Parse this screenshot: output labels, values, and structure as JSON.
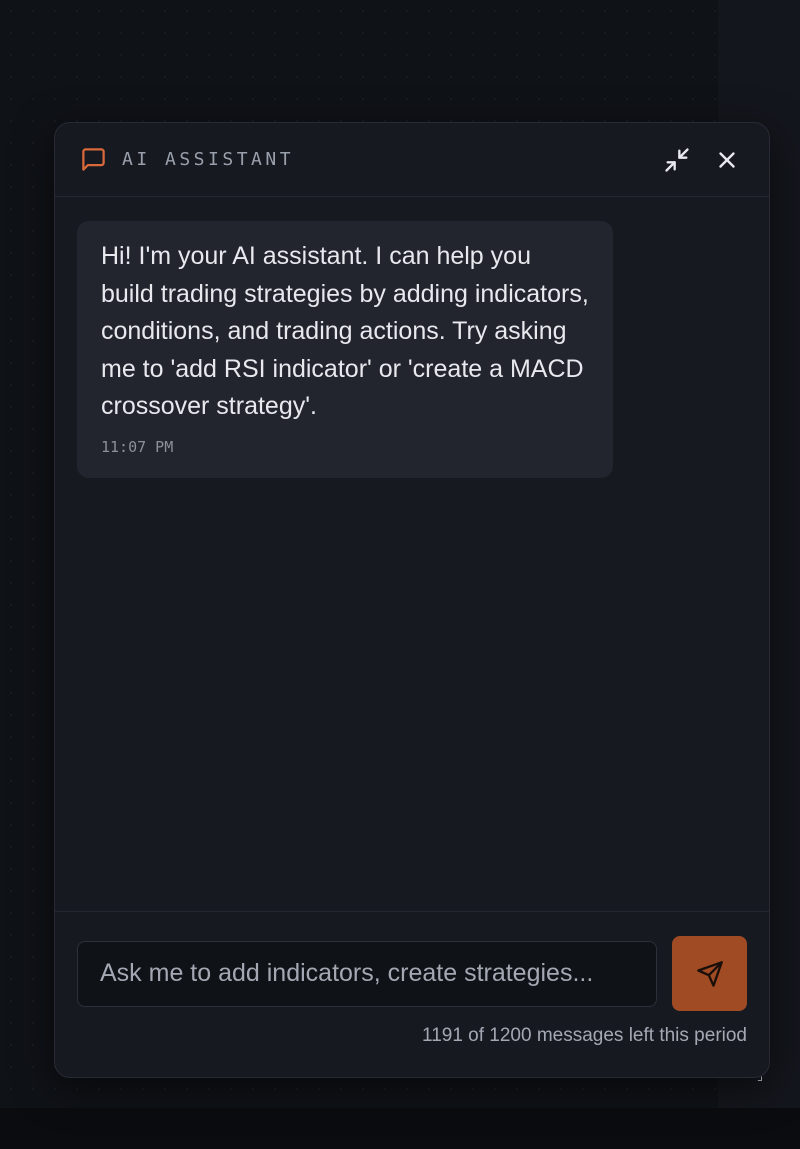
{
  "header": {
    "title": "AI ASSISTANT"
  },
  "messages": [
    {
      "role": "assistant",
      "text": "Hi! I'm your AI assistant. I can help you build trading strategies by adding indicators, conditions, and trading actions. Try asking me to 'add RSI indicator' or 'create a MACD crossover strategy'.",
      "time": "11:07 PM"
    }
  ],
  "composer": {
    "placeholder": "Ask me to add indicators, create strategies...",
    "quota_text": "1191 of 1200 messages left this period"
  },
  "icons": {
    "chat": "message-square-icon",
    "minimize": "minimize-icon",
    "close": "close-icon",
    "send": "send-icon"
  },
  "colors": {
    "accent": "#d9693a",
    "send_button": "#a14b24",
    "panel_bg": "#161920",
    "bubble_bg": "#22252d"
  }
}
